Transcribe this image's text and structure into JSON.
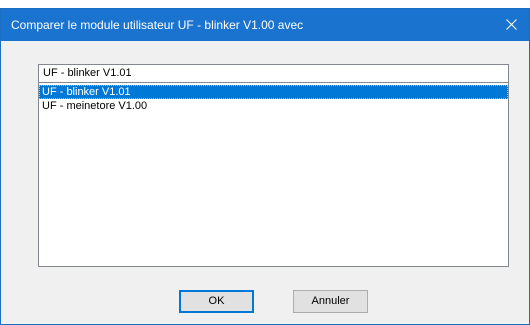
{
  "dialog": {
    "title": "Comparer le module utilisateur UF - blinker V1.00 avec",
    "close_icon": "close-icon"
  },
  "combo": {
    "value": "UF - blinker V1.01",
    "items": [
      {
        "label": "UF - blinker V1.01",
        "selected": true
      },
      {
        "label": "UF - meinetore V1.00",
        "selected": false
      }
    ]
  },
  "buttons": {
    "ok_label": "OK",
    "cancel_label": "Annuler"
  },
  "colors": {
    "titlebar": "#1a73cf",
    "selection": "#0078d7",
    "dialog_bg": "#f0f0f0"
  }
}
